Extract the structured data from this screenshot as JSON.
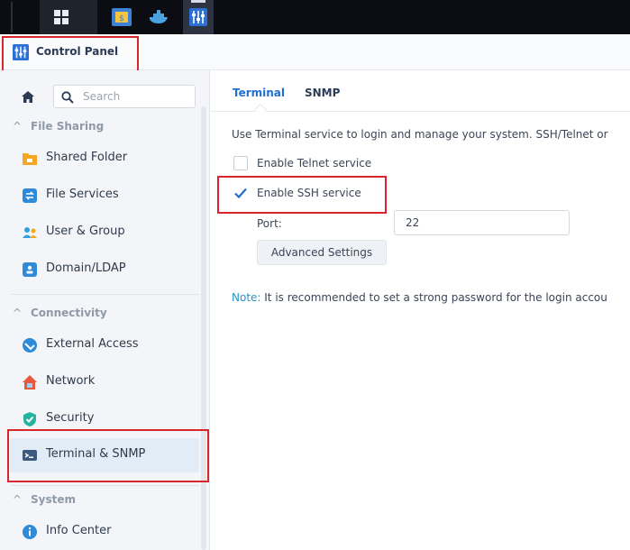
{
  "window": {
    "title": "Control Panel"
  },
  "taskbar": {
    "apps": [
      "main-menu-icon",
      "storage-manager-icon",
      "container-manager-icon",
      "control-panel-icon"
    ]
  },
  "sidebar": {
    "search_placeholder": "Search",
    "sections": [
      {
        "label": "File Sharing"
      },
      {
        "label": "Connectivity"
      },
      {
        "label": "System"
      }
    ],
    "items": [
      {
        "label": "Shared Folder",
        "icon": "folder-icon",
        "color": "#f5a623"
      },
      {
        "label": "File Services",
        "icon": "file-services-icon",
        "color": "#2f8ad8"
      },
      {
        "label": "User & Group",
        "icon": "user-group-icon",
        "color": "#2fa0e0"
      },
      {
        "label": "Domain/LDAP",
        "icon": "domain-icon",
        "color": "#2f8ad8"
      },
      {
        "label": "External Access",
        "icon": "external-access-icon",
        "color": "#2f8ad8"
      },
      {
        "label": "Network",
        "icon": "network-icon",
        "color": "#e8593b"
      },
      {
        "label": "Security",
        "icon": "security-shield-icon",
        "color": "#25b39e"
      },
      {
        "label": "Terminal & SNMP",
        "icon": "terminal-icon",
        "color": "#3c5a80",
        "selected": true
      },
      {
        "label": "Info Center",
        "icon": "info-icon",
        "color": "#2f8ad8"
      }
    ]
  },
  "main": {
    "tabs": [
      {
        "label": "Terminal",
        "active": true
      },
      {
        "label": "SNMP",
        "active": false
      }
    ],
    "description": "Use Terminal service to login and manage your system. SSH/Telnet or",
    "telnet": {
      "label": "Enable Telnet service",
      "checked": false
    },
    "ssh": {
      "label": "Enable SSH service",
      "checked": true
    },
    "port": {
      "label": "Port:",
      "value": "22"
    },
    "advanced_button": "Advanced Settings",
    "note": {
      "key": "Note:",
      "text": " It is recommended to set a strong password for the login accou"
    }
  },
  "colors": {
    "accent": "#1f6fd1",
    "highlight": "#d9262c",
    "selected_bg": "#e2ecf7"
  }
}
